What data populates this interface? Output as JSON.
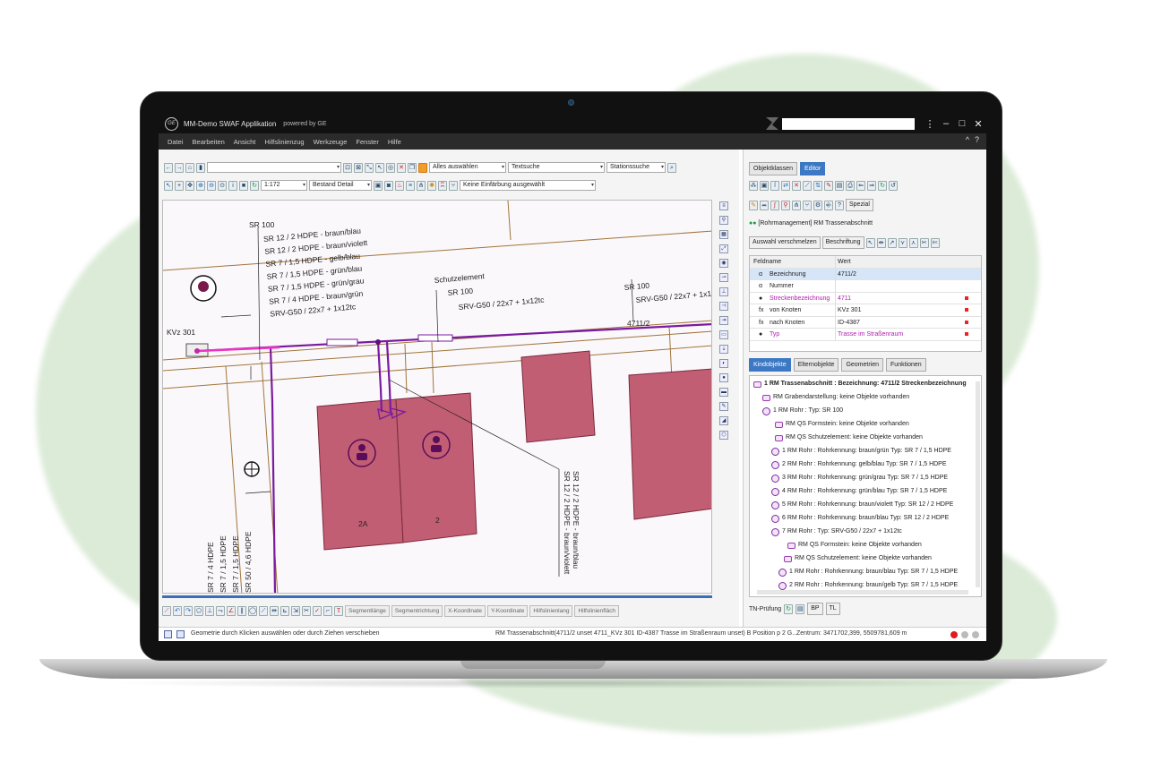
{
  "app": {
    "title": "MM-Demo SWAF Applikation",
    "powered": "powered by GE",
    "logo_text": "GE",
    "window_buttons": [
      "⋮",
      "–",
      "□",
      "✕"
    ]
  },
  "menu": {
    "items": [
      "Datei",
      "Bearbeiten",
      "Ansicht",
      "Hilfslinienzug",
      "Werkzeuge",
      "Fenster",
      "Hilfe"
    ],
    "right": [
      "^",
      "?"
    ]
  },
  "toolbar": {
    "select_all": "Alles auswählen",
    "text_search": "Textsuche",
    "station_search": "Stationssuche",
    "scale": "1:172",
    "detail": "Bestand Detail",
    "coloring": "Keine Einfärbung ausgewählt"
  },
  "map": {
    "labels": {
      "sr100_a": "SR 100",
      "sr100_b": "SR 100",
      "sr100_c": "SR 100",
      "schutzelement": "Schutzelement",
      "kvz": "KVz 301",
      "srv_mid": "SRV-G50 / 22x7 + 1x12tc",
      "srv_right": "SRV-G50 / 22x7 + 1x12tc",
      "id4711": "4711/2",
      "house_2a": "2A",
      "house_2": "2"
    },
    "pipe_list": [
      "SR 12 / 2 HDPE - braun/blau",
      "SR 12 / 2 HDPE - braun/violett",
      "SR 7 / 1,5 HDPE - gelb/blau",
      "SR 7 / 1,5 HDPE - grün/blau",
      "SR 7 / 1,5 HDPE - grün/grau",
      "SR 7 / 4 HDPE - braun/grün",
      "SRV-G50 / 22x7 + 1x12tc"
    ],
    "rotated_right": [
      "SR 12 / 2 HDPE - braun/blau",
      "SR 12 / 2 HDPE - braun/violett"
    ],
    "rotated_left": [
      "SR 50 / 4,6 HDPE",
      "SR 7 / 1,5 HDPE",
      "SR 7 / 1,5 HDPE",
      "SR 7 / 4 HDPE"
    ]
  },
  "bottom_tools": [
    "Segmentlänge",
    "Segmentrichtung",
    "X-Koordinate",
    "Y-Koordinate",
    "Hilfslinienlang",
    "Hilfslinienfläch"
  ],
  "status": {
    "message": "Geometrie durch Klicken auswählen oder durch Ziehen verschieben",
    "selection": "RM Trassenabschnitt(4711/2 unset 4711_KVz 301 ID-4387 Trasse im Straßenraum unset) B Position p 2 G...",
    "center": "Zentrum: 3471702,399, 5509781,609 m"
  },
  "right": {
    "tabs": [
      "Objektklassen",
      "Editor"
    ],
    "spezial": "Spezial",
    "heading": "[Rohrmanagement] RM Trassenabschnitt",
    "merge_btn": "Auswahl verschmelzen",
    "label_btn": "Beschriftung",
    "grid_headers": [
      "Feldname",
      "Wert"
    ],
    "grid_rows": [
      {
        "icon": "α",
        "name": "Bezeichnung",
        "value": "4711/2"
      },
      {
        "icon": "α",
        "name": "Nummer",
        "value": ""
      },
      {
        "icon": "●",
        "name": "Streckenbezeichnung",
        "value": "4711"
      },
      {
        "icon": "fx",
        "name": "von Knoten",
        "value": "KVz 301"
      },
      {
        "icon": "fx",
        "name": "nach Knoten",
        "value": "ID-4387"
      },
      {
        "icon": "●",
        "name": "Typ",
        "value": "Trasse im Straßenraum"
      }
    ],
    "bottom_tabs": [
      "Kindobjekte",
      "Elternobjekte",
      "Geometrien",
      "Funktionen"
    ],
    "tree": [
      "1 RM Trassenabschnitt :  Bezeichnung: 4711/2 Streckenbezeichnung",
      "RM Grabendarstellung: keine Objekte vorhanden",
      "1 RM Rohr :   Typ: SR 100",
      "RM QS Formstein: keine Objekte vorhanden",
      "RM QS Schutzelement: keine Objekte vorhanden",
      "1 RM Rohr :   Rohrkennung: braun/grün Typ: SR 7 / 1,5 HDPE",
      "2 RM Rohr :   Rohrkennung: gelb/blau Typ: SR 7 / 1,5 HDPE",
      "3 RM Rohr :   Rohrkennung: grün/grau Typ: SR 7 / 1,5 HDPE",
      "4 RM Rohr :   Rohrkennung: grün/blau Typ: SR 7 / 1,5 HDPE",
      "5 RM Rohr :   Rohrkennung: braun/violett Typ: SR 12 / 2 HDPE",
      "6 RM Rohr :   Rohrkennung: braun/blau Typ: SR 12 / 2 HDPE",
      "7 RM Rohr :   Typ: SRV-G50 / 22x7 + 1x12tc",
      "RM QS Formstein: keine Objekte vorhanden",
      "RM QS Schutzelement: keine Objekte vorhanden",
      "1 RM Rohr :   Rohrkennung: braun/blau Typ: SR 7 / 1,5 HDPE",
      "2 RM Rohr :   Rohrkennung: braun/gelb Typ: SR 7 / 1,5 HDPE"
    ],
    "tn_label": "TN-Prüfung",
    "tn_btns": [
      "BP",
      "TL"
    ]
  },
  "colors": {
    "accent": "#3c78c3",
    "pipe": "#7a1aa0",
    "house": "#c25e74",
    "road": "#a0753a"
  }
}
